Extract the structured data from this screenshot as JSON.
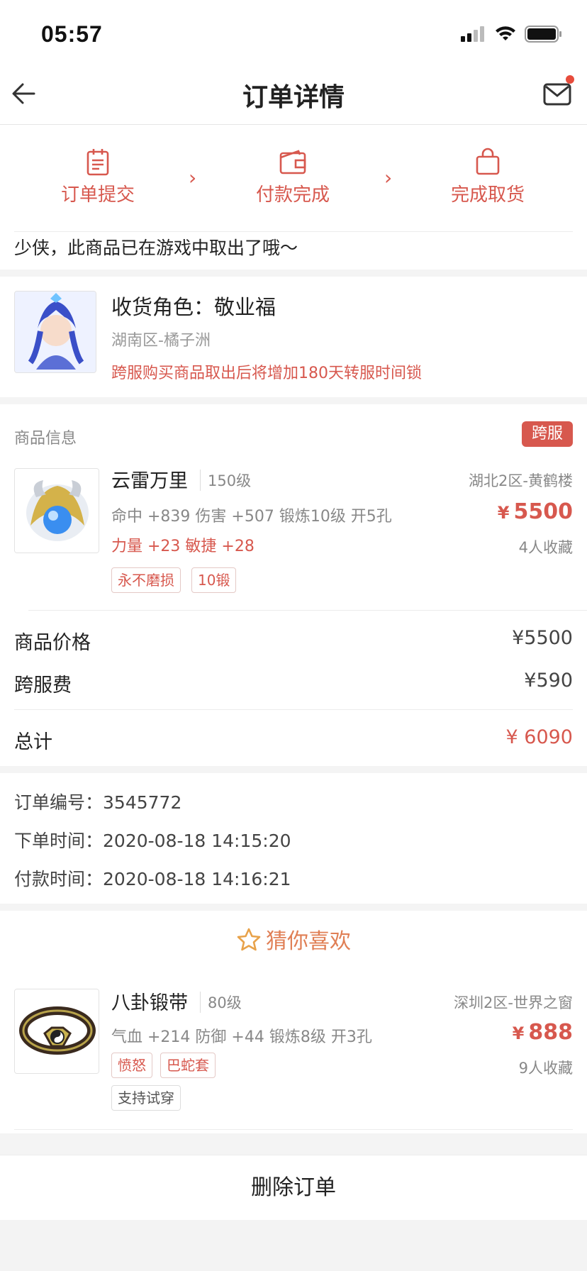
{
  "status_bar": {
    "time": "05:57"
  },
  "nav": {
    "title": "订单详情",
    "back_icon": "arrow-left-icon",
    "mail_icon": "mail-icon",
    "mail_badge_color": "#e74c3c"
  },
  "steps": [
    {
      "label": "订单提交",
      "icon": "clipboard-icon"
    },
    {
      "label": "付款完成",
      "icon": "wallet-icon"
    },
    {
      "label": "完成取货",
      "icon": "shopping-bag-icon"
    }
  ],
  "status_message": "少侠，此商品已在游戏中取出了哦～",
  "receiver": {
    "label": "收货角色：",
    "name": "敬业福",
    "server": "湖南区-橘子洲",
    "warning": "跨服购买商品取出后将增加180天转服时间锁"
  },
  "goods_section": {
    "title": "商品信息",
    "badge": "跨服"
  },
  "item": {
    "name": "云雷万里",
    "level": "150级",
    "server": "湖北2区-黄鹤楼",
    "stats": "命中 +839 伤害 +507 锻炼10级 开5孔",
    "stats_extra": "力量 +23 敏捷 +28",
    "currency": "¥",
    "price": "5500",
    "favorites": "4人收藏",
    "tags": [
      "永不磨损",
      "10锻"
    ]
  },
  "pricing": {
    "goods_price_label": "商品价格",
    "goods_price_value": "¥5500",
    "cross_fee_label": "跨服费",
    "cross_fee_value": "¥590",
    "total_label": "总计",
    "total_value": "¥ 6090"
  },
  "order_info": {
    "number_label": "订单编号：",
    "number_value": "3545772",
    "order_time_label": "下单时间：",
    "order_time_value": "2020-08-18 14:15:20",
    "pay_time_label": "付款时间：",
    "pay_time_value": "2020-08-18 14:16:21"
  },
  "recommend": {
    "title": "猜你喜欢",
    "icon": "star-icon",
    "item": {
      "name": "八卦锻带",
      "level": "80级",
      "server": "深圳2区-世界之窗",
      "stats": "气血 +214 防御 +44 锻炼8级 开3孔",
      "currency": "¥",
      "price": "888",
      "favorites": "9人收藏",
      "tags": [
        "愤怒",
        "巴蛇套"
      ],
      "tags_gray": [
        "支持试穿"
      ]
    }
  },
  "actions": {
    "delete_label": "删除订单"
  },
  "colors": {
    "accent": "#d7584e",
    "muted": "#888888",
    "band": "#f4f4f4"
  }
}
